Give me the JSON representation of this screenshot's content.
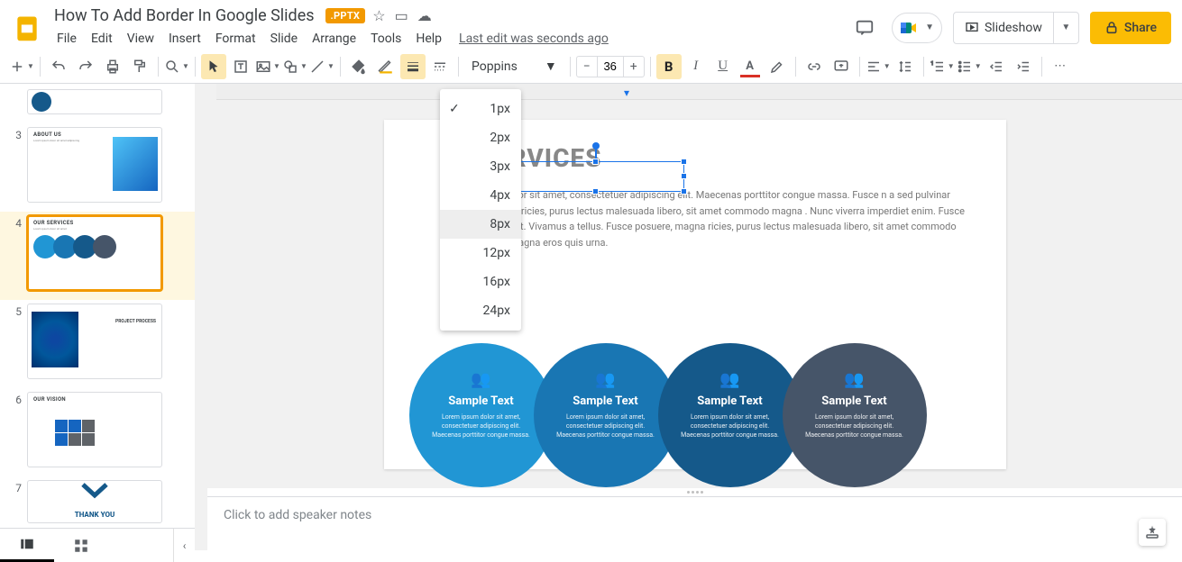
{
  "doc": {
    "title": "How To Add Border In Google Slides",
    "badge": ".PPTX",
    "last_edit": "Last edit was seconds ago"
  },
  "title_icons": {
    "star": "☆",
    "move": "⟶",
    "cloud": "☁"
  },
  "menu": {
    "file": "File",
    "edit": "Edit",
    "view": "View",
    "insert": "Insert",
    "format": "Format",
    "slide": "Slide",
    "arrange": "Arrange",
    "tools": "Tools",
    "help": "Help"
  },
  "header": {
    "slideshow": "Slideshow",
    "share": "Share"
  },
  "toolbar": {
    "font": "Poppins",
    "font_size": "36"
  },
  "border_weight_options": [
    "1px",
    "2px",
    "3px",
    "4px",
    "8px",
    "12px",
    "16px",
    "24px"
  ],
  "border_weight_selected": "1px",
  "border_weight_hovered": "8px",
  "thumbs": {
    "n3": "3",
    "t3": "ABOUT US",
    "n4": "4",
    "t4": "OUR SERVICES",
    "n5": "5",
    "t5": "PROJECT PROCESS",
    "n6": "6",
    "t6": "OUR VISION",
    "n7": "7",
    "t7": "THANK YOU"
  },
  "slide": {
    "title_visible": "RVICES",
    "para": "olor sit amet, consectetuer adipiscing elit. Maecenas porttitor congue massa. Fusce n a sed pulvinar ultricies, purus lectus malesuada libero, sit amet commodo magna . Nunc viverra imperdiet enim. Fusce est. Vivamus a tellus. Fusce posuere, magna ricies, purus lectus malesuada libero, sit amet commodo magna eros quis urna.",
    "circle_title": "Sample Text",
    "circle_sub": "Lorem ipsum dolor sit amet, consectetuer adipiscing elit. Maecenas porttitor congue massa."
  },
  "notes": {
    "placeholder": "Click to add speaker notes"
  }
}
